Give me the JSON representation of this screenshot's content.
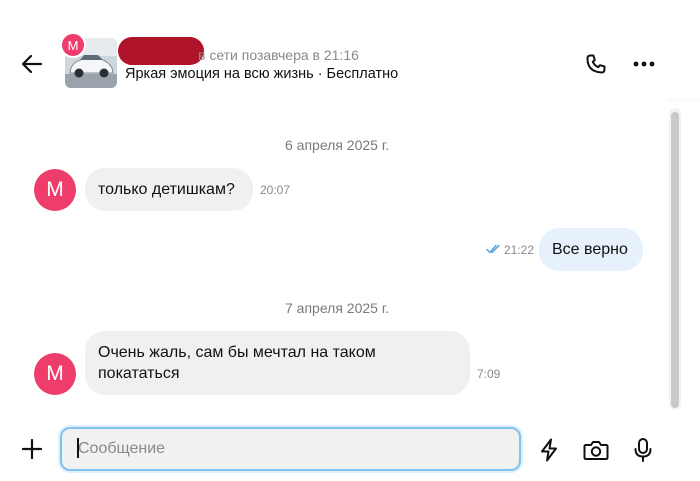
{
  "header": {
    "avatar_letter": "M",
    "status": "в сети позавчера в 21:16",
    "listing_title": "Яркая эмоция на всю жизнь · Бесплатно"
  },
  "messages": [
    {
      "type": "date",
      "text": "6 апреля 2025 г."
    },
    {
      "type": "incoming",
      "avatar_letter": "M",
      "text": "только детишкам?",
      "time": "20:07"
    },
    {
      "type": "outgoing",
      "text": "Все верно",
      "time": "21:22",
      "read": true
    },
    {
      "type": "date",
      "text": "7 апреля 2025 г."
    },
    {
      "type": "incoming",
      "avatar_letter": "M",
      "text_line1": "Очень жаль, сам бы мечтал на таком",
      "text_line2": "покататься",
      "time": "7:09"
    }
  ],
  "composer": {
    "placeholder": "Сообщение",
    "value": ""
  },
  "colors": {
    "avatar": "#ee3d6b",
    "incoming_bubble": "#f1f0ef",
    "outgoing_bubble": "#e6f1fb",
    "input_focus_border": "#7fc1ef",
    "read_ticks": "#4a9fe0"
  },
  "icons": [
    "back-arrow-icon",
    "phone-icon",
    "more-dots-icon",
    "plus-icon",
    "bolt-icon",
    "camera-icon",
    "microphone-icon",
    "double-check-icon"
  ]
}
